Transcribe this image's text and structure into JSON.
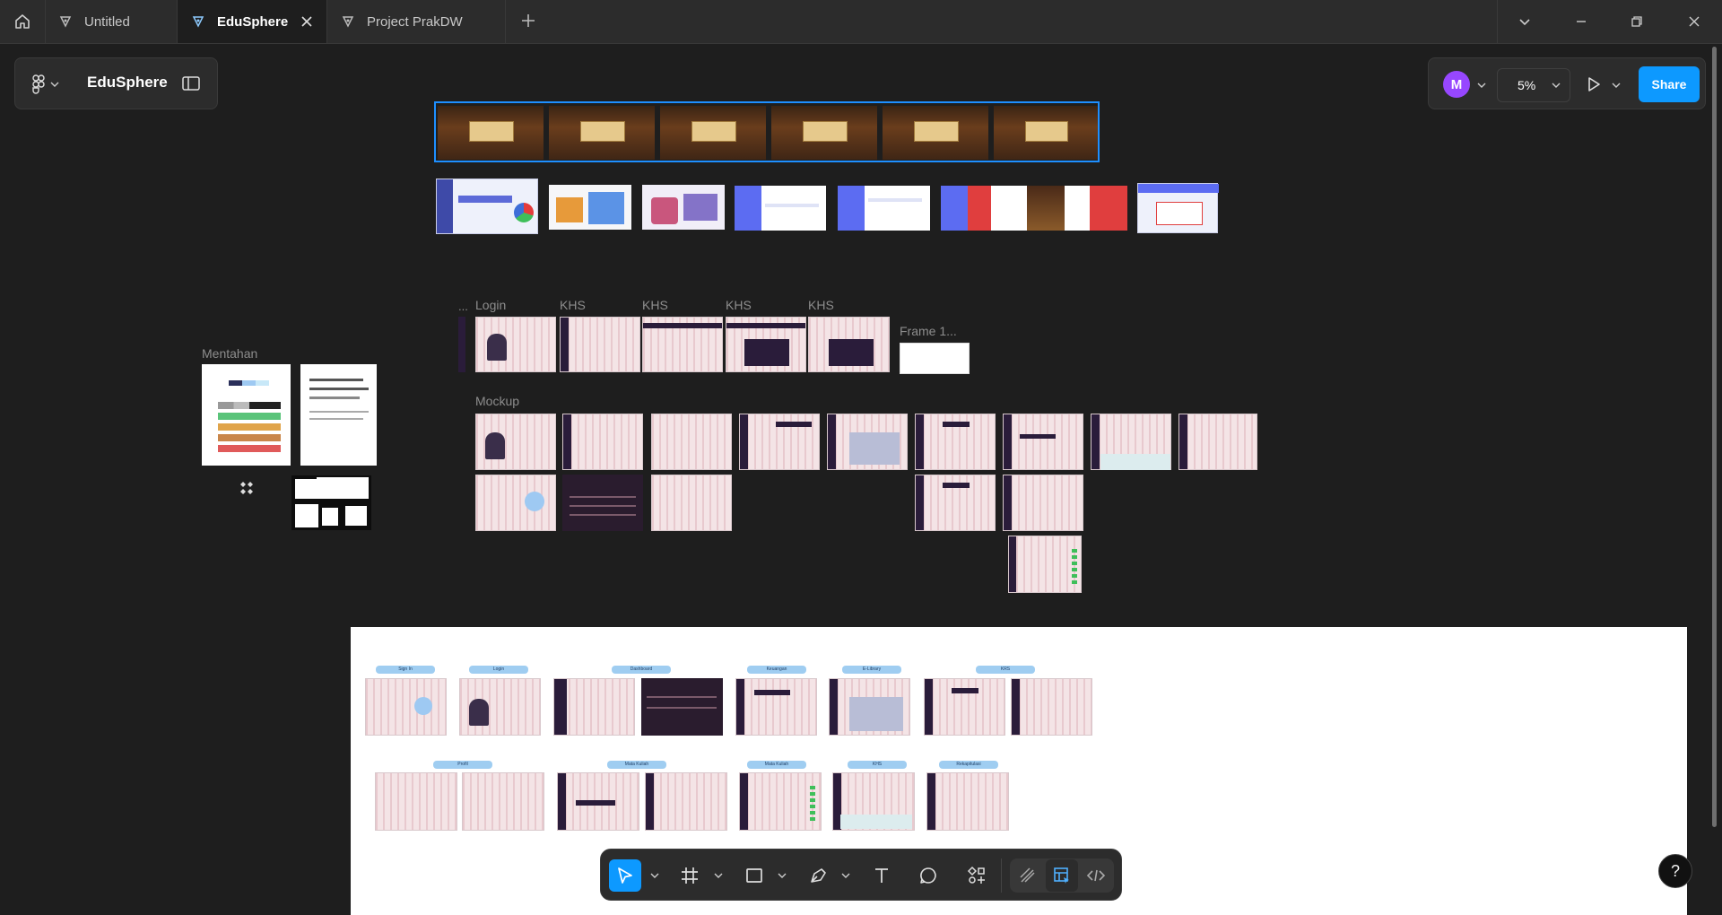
{
  "tabs": [
    {
      "label": "Untitled"
    },
    {
      "label": "EduSphere"
    },
    {
      "label": "Project PrakDW"
    }
  ],
  "file_panel": {
    "title": "EduSphere"
  },
  "header": {
    "avatar_initial": "M",
    "zoom": "5%",
    "share_label": "Share"
  },
  "canvas": {
    "labels": {
      "ellipsis": "...",
      "login": "Login",
      "khs1": "KHS",
      "khs2": "KHS",
      "khs3": "KHS",
      "khs4": "KHS",
      "frame": "Frame 1...",
      "mentahan": "Mentahan",
      "mockup": "Mockup"
    },
    "board_tags": {
      "sign_in": "Sign In",
      "login": "Login",
      "dashboard": "Dashboard",
      "keuangan": "Keuangan",
      "elibrary": "E-Library",
      "krs": "KRS",
      "profil": "Profil",
      "mata_kuliah_1": "Mata Kuliah",
      "mata_kuliah_2": "Mata Kuliah",
      "khs": "KHS",
      "rekapitulasi": "Rekapitulasi"
    }
  },
  "help": {
    "label": "?"
  },
  "colors": {
    "accent": "#0d99ff",
    "avatar": "#9747ff",
    "canvas": "#1e1e1e",
    "chrome": "#2c2c2c"
  }
}
